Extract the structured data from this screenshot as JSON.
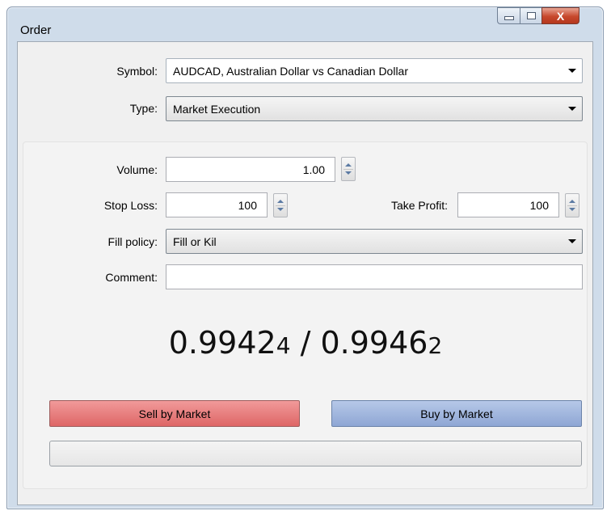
{
  "window": {
    "title": "Order",
    "close_glyph": "X",
    "icons": [
      "minimize-icon",
      "maximize-icon",
      "close-icon"
    ]
  },
  "form": {
    "symbol_label": "Symbol:",
    "symbol_value": "AUDCAD, Australian Dollar vs Canadian Dollar",
    "type_label": "Type:",
    "type_value": "Market Execution",
    "volume_label": "Volume:",
    "volume_value": "1.00",
    "stop_loss_label": "Stop Loss:",
    "stop_loss_value": "100",
    "take_profit_label": "Take Profit:",
    "take_profit_value": "100",
    "fill_policy_label": "Fill policy:",
    "fill_policy_value": "Fill or Kil",
    "comment_label": "Comment:",
    "comment_value": ""
  },
  "quote": {
    "bid_main": "0.9942",
    "bid_pip": "4",
    "separator": " / ",
    "ask_main": "0.9946",
    "ask_pip": "2"
  },
  "actions": {
    "sell_label": "Sell by Market",
    "buy_label": "Buy by Market"
  },
  "progress": {
    "value": 0
  },
  "colors": {
    "sell": "#e27272",
    "buy": "#95abd7",
    "window_frame": "#cfdcea",
    "close": "#c7482c"
  }
}
